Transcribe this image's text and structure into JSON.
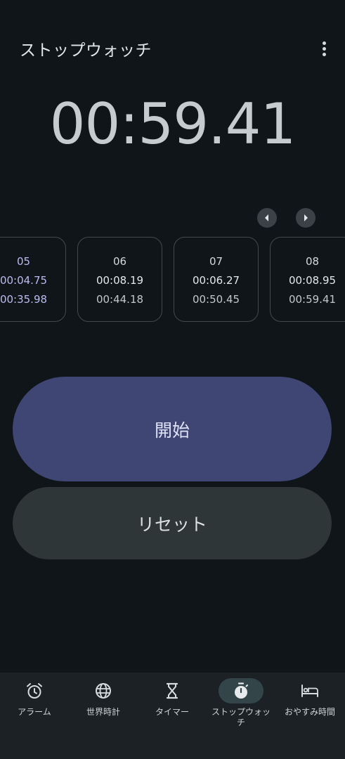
{
  "header": {
    "title": "ストップウォッチ",
    "menu_icon": "more-vert-icon"
  },
  "timer": {
    "elapsed": "00:59.41"
  },
  "lap_nav": {
    "prev_icon": "chevron-left-icon",
    "next_icon": "chevron-right-icon"
  },
  "laps": [
    {
      "number": "05",
      "split": "00:04.75",
      "total": "00:35.98",
      "highlight": "best"
    },
    {
      "number": "06",
      "split": "00:08.19",
      "total": "00:44.18"
    },
    {
      "number": "07",
      "split": "00:06.27",
      "total": "00:50.45"
    },
    {
      "number": "08",
      "split": "00:08.95",
      "total": "00:59.41"
    }
  ],
  "controls": {
    "start_label": "開始",
    "reset_label": "リセット"
  },
  "bottom_nav": {
    "active": "stopwatch",
    "items": [
      {
        "id": "alarm",
        "label": "アラーム",
        "icon": "alarm-clock-icon"
      },
      {
        "id": "world-clock",
        "label": "世界時計",
        "icon": "globe-icon"
      },
      {
        "id": "timer",
        "label": "タイマー",
        "icon": "hourglass-icon"
      },
      {
        "id": "stopwatch",
        "label": "ストップウォッチ",
        "icon": "stopwatch-icon"
      },
      {
        "id": "bedtime",
        "label": "おやすみ時間",
        "icon": "bed-icon"
      }
    ]
  },
  "colors": {
    "background": "#0f1518",
    "start_button": "#3f4674",
    "reset_button": "#2f3638",
    "best_lap_text": "#b9bcf2",
    "nav_background": "#1b2124",
    "nav_active_pill": "#334549"
  }
}
